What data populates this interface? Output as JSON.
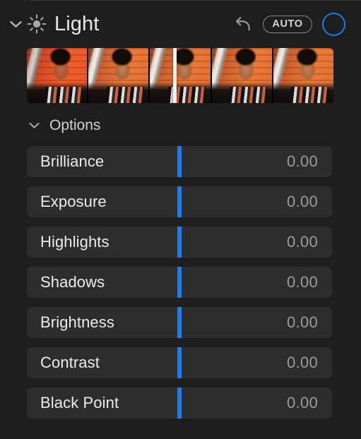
{
  "panel": {
    "background_color": "#1e1e1e",
    "accent_color": "#1a7ef0"
  },
  "header": {
    "collapse_chevron": "chevron-down-icon",
    "icon": "sun-brightness-icon",
    "title": "Light",
    "reset_button": "reset-arrow-icon",
    "auto_label": "AUTO",
    "toggle": "blue-circle-toggle"
  },
  "filmstrip": {
    "name": "light-adjustment-filmstrip",
    "thumbnail_count": 5,
    "selected_index": 2,
    "thumbnails": [
      {
        "tone": "warm",
        "alt": "portrait preview 1"
      },
      {
        "tone": "cool",
        "alt": "portrait preview 2"
      },
      {
        "tone": "cool",
        "alt": "portrait preview 3"
      },
      {
        "tone": "cool",
        "alt": "portrait preview 4"
      },
      {
        "tone": "cool",
        "alt": "portrait preview 5"
      }
    ]
  },
  "options": {
    "chevron": "chevron-down-icon",
    "label": "Options"
  },
  "sliders": [
    {
      "label": "Brilliance",
      "value": "0.00",
      "position_pct": 50
    },
    {
      "label": "Exposure",
      "value": "0.00",
      "position_pct": 50
    },
    {
      "label": "Highlights",
      "value": "0.00",
      "position_pct": 50
    },
    {
      "label": "Shadows",
      "value": "0.00",
      "position_pct": 50
    },
    {
      "label": "Brightness",
      "value": "0.00",
      "position_pct": 50
    },
    {
      "label": "Contrast",
      "value": "0.00",
      "position_pct": 50
    },
    {
      "label": "Black Point",
      "value": "0.00",
      "position_pct": 50
    }
  ]
}
